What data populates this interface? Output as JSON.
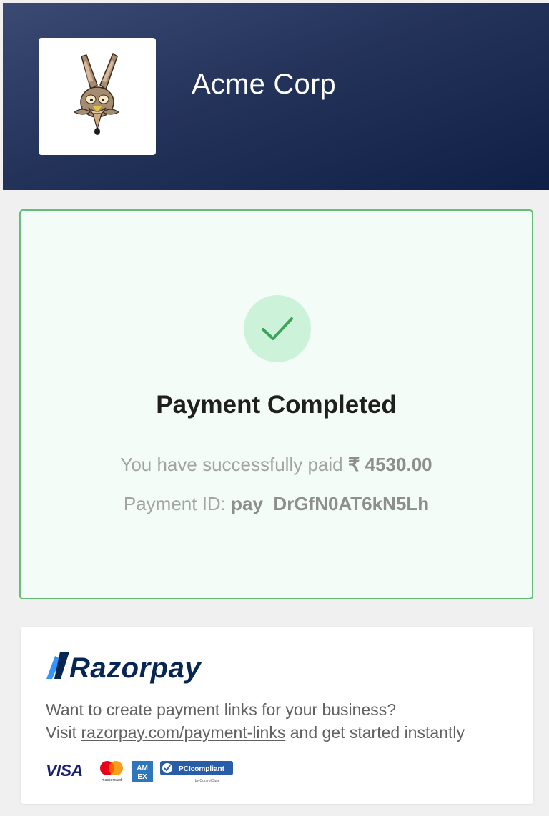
{
  "header": {
    "company_name": "Acme Corp",
    "logo_icon": "coyote-logo-icon"
  },
  "status": {
    "icon": "checkmark-icon",
    "title": "Payment Completed",
    "paid_prefix": "You have successfully paid",
    "amount": "₹ 4530.00",
    "payment_id_label": "Payment ID:",
    "payment_id": "pay_DrGfN0AT6kN5Lh"
  },
  "promo": {
    "brand": "Razorpay",
    "line1": "Want to create payment links for your business?",
    "line2_prefix": "Visit",
    "link_text": "razorpay.com/payment-links",
    "line2_suffix": "and get started instantly",
    "badges": {
      "visa": "VISA",
      "mastercard": "mastercard",
      "amex": "AM EX",
      "pci": "PCIcompliant",
      "pci_sub": "by ControlCase"
    }
  },
  "colors": {
    "header_dark": "#0f1f45",
    "success_border": "#63be77",
    "success_bg": "#f3fcf6",
    "check_green": "#3fa35b",
    "razorpay_blue": "#072654",
    "razorpay_accent": "#3395ff"
  }
}
